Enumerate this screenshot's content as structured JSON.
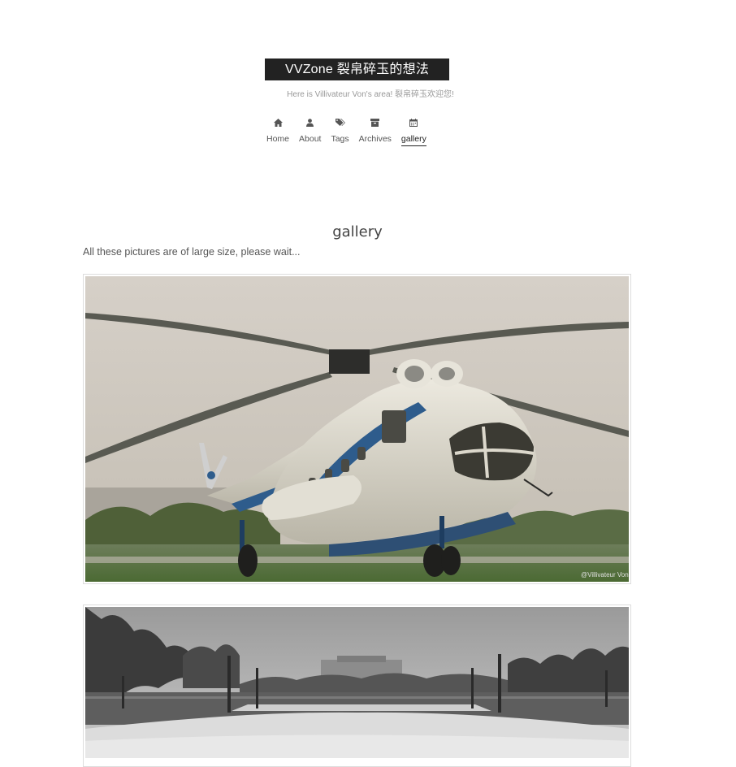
{
  "header": {
    "brand": "VVZone 裂帛碎玉的想法",
    "subtitle": "Here is Villivateur Von's area! 裂帛碎玉欢迎您!"
  },
  "nav": {
    "items": [
      {
        "label": "Home",
        "icon": "home-icon"
      },
      {
        "label": "About",
        "icon": "user-icon"
      },
      {
        "label": "Tags",
        "icon": "tags-icon"
      },
      {
        "label": "Archives",
        "icon": "archive-icon"
      },
      {
        "label": "gallery",
        "icon": "calendar-icon",
        "active": true
      }
    ]
  },
  "page": {
    "title": "gallery",
    "intro": "All these pictures are of large size, please wait..."
  },
  "gallery": {
    "photos": [
      {
        "subject": "snow-covered helicopter",
        "watermark": "@Villivateur Von"
      },
      {
        "subject": "snowy plaza with trees and water"
      }
    ]
  },
  "colors": {
    "brand_bg": "#222222",
    "text": "#555555",
    "muted": "#999999",
    "border": "#dddddd"
  }
}
